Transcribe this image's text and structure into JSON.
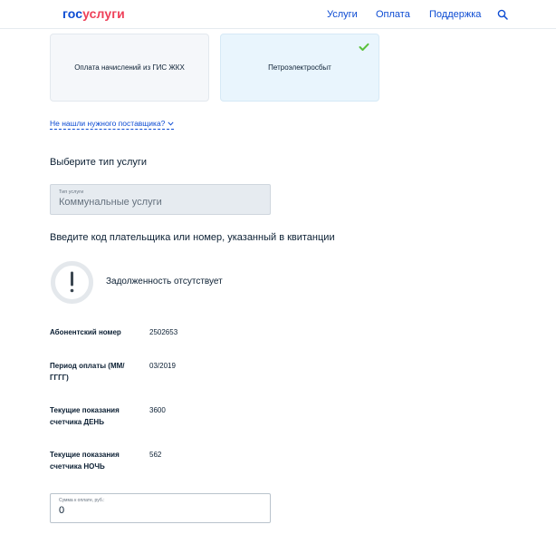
{
  "header": {
    "logo_part1": "гос",
    "logo_part2": "услуги",
    "nav": [
      "Услуги",
      "Оплата",
      "Поддержка"
    ]
  },
  "providers": [
    {
      "label": "Оплата начислений из ГИС ЖКХ",
      "selected": false
    },
    {
      "label": "Петроэлектросбыт",
      "selected": true
    }
  ],
  "not_found_link": "Не нашли нужного поставщика?",
  "service_type": {
    "title": "Выберите тип услуги",
    "field_label": "Тип услуги",
    "value": "Коммунальные услуги"
  },
  "payer_title": "Введите код плательщика или номер, указанный в квитанции",
  "status_text": "Задолженность отсутствует",
  "details": [
    {
      "label": "Абонентский номер",
      "value": "2502653"
    },
    {
      "label": "Период оплаты (ММ/ГГГГ)",
      "value": "03/2019"
    },
    {
      "label": "Текущие показания счетчика ДЕНЬ",
      "value": "3600"
    },
    {
      "label": "Текущие показания счетчика НОЧЬ",
      "value": "562"
    }
  ],
  "amount": {
    "label": "Сумма к оплате, руб.:",
    "value": "0"
  },
  "colors": {
    "link_blue": "#0d4cd3",
    "logo_red": "#ee3f58",
    "check_green": "#5ac13b",
    "selected_card_bg": "#e9f5fd"
  }
}
